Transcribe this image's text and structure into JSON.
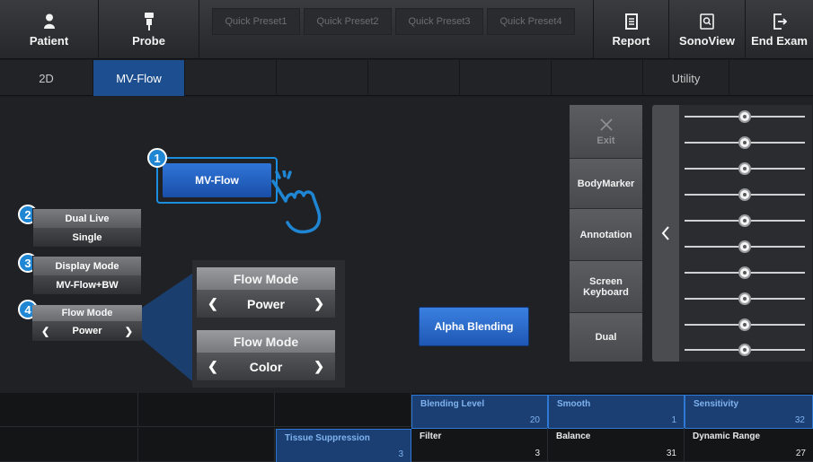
{
  "toolbar": {
    "patient_label": "Patient",
    "probe_label": "Probe",
    "presets": [
      "Quick Preset1",
      "Quick Preset2",
      "Quick Preset3",
      "Quick Preset4"
    ],
    "report_label": "Report",
    "sonoview_label": "SonoView",
    "end_exam_label": "End Exam"
  },
  "tabs": {
    "tab_2d": "2D",
    "tab_mvflow": "MV-Flow",
    "tab_utility": "Utility",
    "active": "MV-Flow"
  },
  "main": {
    "mvflow_button": "MV-Flow",
    "callouts": [
      "1",
      "2",
      "3",
      "4"
    ],
    "dual_live": {
      "title": "Dual Live",
      "value": "Single"
    },
    "display_mode": {
      "title": "Display Mode",
      "value": "MV-Flow+BW"
    },
    "flow_mode_small": {
      "title": "Flow Mode",
      "value": "Power"
    },
    "flow_mode_power": {
      "title": "Flow Mode",
      "value": "Power"
    },
    "flow_mode_color": {
      "title": "Flow Mode",
      "value": "Color"
    },
    "alpha_blending": "Alpha Blending"
  },
  "utility": {
    "exit_label": "Exit",
    "bodymarker_label": "BodyMarker",
    "annotation_label": "Annotation",
    "screen_keyboard_line1": "Screen",
    "screen_keyboard_line2": "Keyboard",
    "dual_label": "Dual",
    "tgc_slider_levels": [
      0.5,
      0.5,
      0.5,
      0.5,
      0.5,
      0.5,
      0.5,
      0.5,
      0.5,
      0.5
    ]
  },
  "params": {
    "blending_level": {
      "label": "Blending Level",
      "value": "20"
    },
    "smooth": {
      "label": "Smooth",
      "value": "1"
    },
    "sensitivity": {
      "label": "Sensitivity",
      "value": "32"
    },
    "tissue_suppression": {
      "label": "Tissue Suppression",
      "value": "3"
    },
    "filter": {
      "label": "Filter",
      "value": "3"
    },
    "balance": {
      "label": "Balance",
      "value": "31"
    },
    "dynamic_range": {
      "label": "Dynamic Range",
      "value": "27"
    }
  },
  "colors": {
    "accent_blue": "#1f57b4",
    "highlight_blue": "#1b8ee0",
    "param_blue_text": "#7fb3ef"
  }
}
